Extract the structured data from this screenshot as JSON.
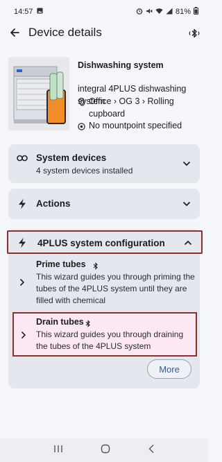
{
  "status_bar": {
    "time": "14:57",
    "battery": "81%"
  },
  "appbar": {
    "title": "Device details",
    "back_icon": "arrow-left-icon",
    "bluetooth_icon": "bluetooth-icon"
  },
  "device": {
    "name": "Dishwashing system",
    "model": "integral 4PLUS dishwashing system",
    "location": "Office › OG 3 › Rolling cupboard",
    "mountpoint": "No mountpoint specified"
  },
  "system_devices": {
    "title": "System devices",
    "subtitle": "4 system devices installed"
  },
  "actions": {
    "title": "Actions"
  },
  "config": {
    "title": "4PLUS system configuration",
    "items": [
      {
        "title": "Prime tubes",
        "description": "This wizard guides you through priming the tubes of the 4PLUS system until they are filled with chemical"
      },
      {
        "title": "Drain tubes",
        "description": "This wizard guides you through draining the tubes of the 4PLUS system"
      }
    ],
    "more_label": "More"
  },
  "colors": {
    "highlight_border": "#8b2f2a",
    "card_bg": "#e4e7ee",
    "accent": "#3a5a8c"
  }
}
